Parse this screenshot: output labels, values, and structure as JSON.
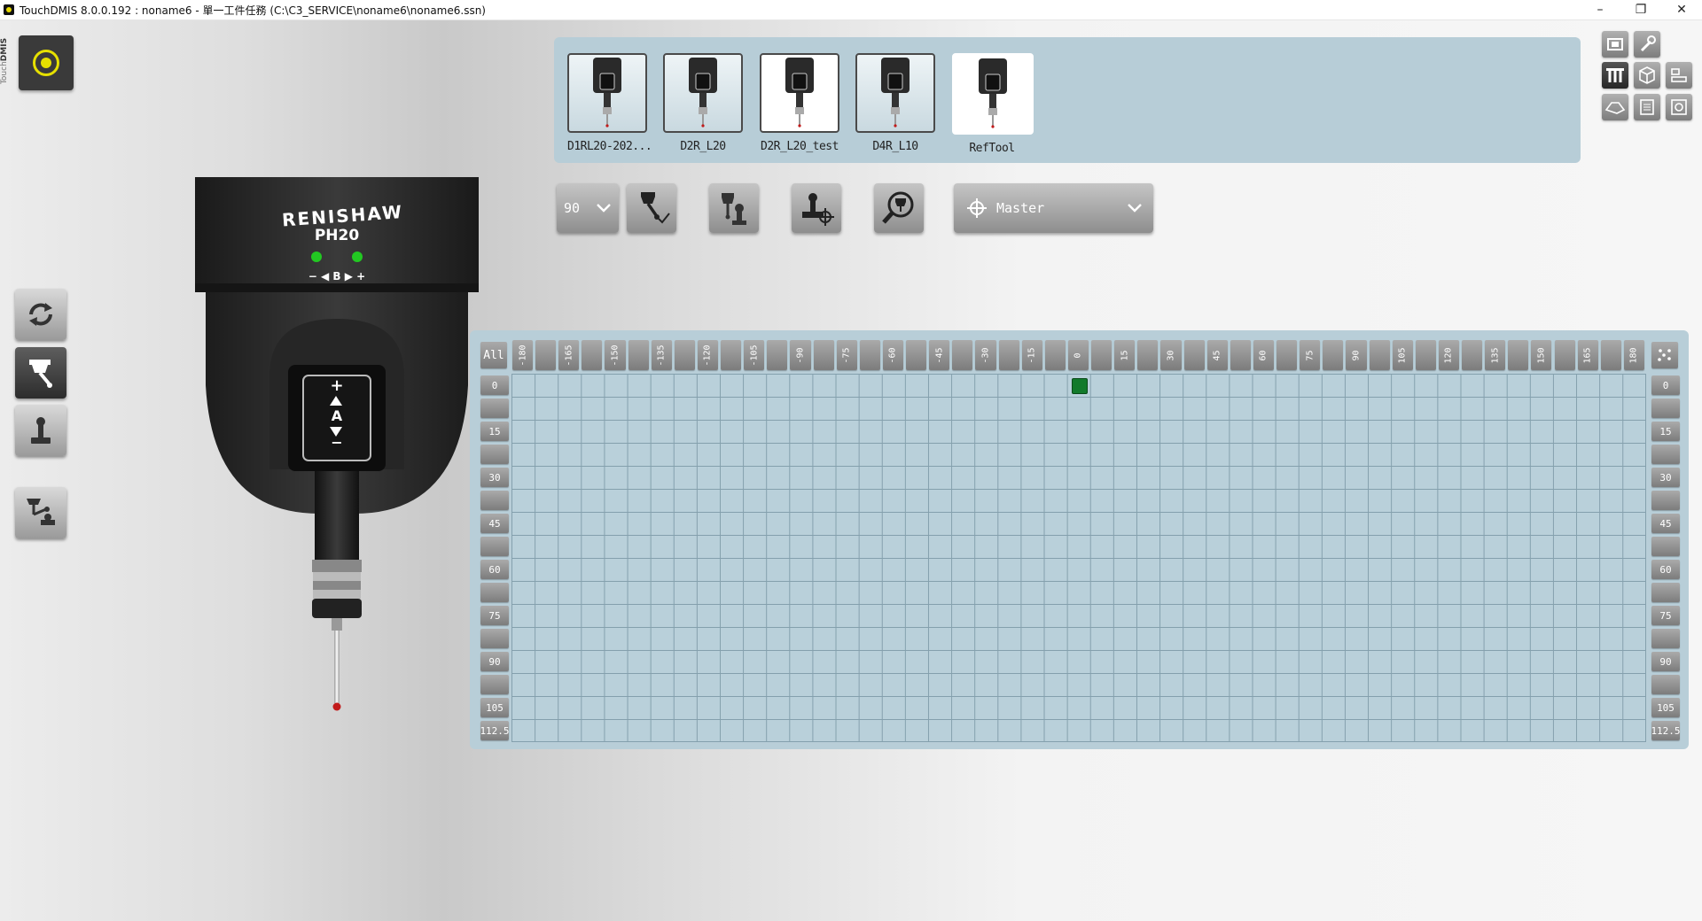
{
  "window": {
    "title": "TouchDMIS 8.0.0.192 :  noname6 - 單一工件任務    (C:\\C3_SERVICE\\noname6\\noname6.ssn)",
    "controls": [
      "–",
      "❐",
      "✕"
    ]
  },
  "brand": {
    "prefix": "Touch",
    "strong": "DMIS"
  },
  "probe_head": {
    "maker": "RENISHAW",
    "model": "PH20",
    "b_axis_label": "− ◀ B ▶ +",
    "a_axis_plus": "+",
    "a_axis_label": "A",
    "a_axis_minus": "−",
    "led_color": "#22c822"
  },
  "tools": [
    {
      "label": "D1RL20-202...",
      "selected": false
    },
    {
      "label": "D2R_L20",
      "selected": false
    },
    {
      "label": "D2R_L20_test",
      "selected": false,
      "highlight": true
    },
    {
      "label": "D4R_L10",
      "selected": false
    },
    {
      "label": "RefTool",
      "selected": true
    }
  ],
  "toolbar": {
    "angle_value": "90",
    "reference_value": "Master"
  },
  "grid": {
    "all_label": "All",
    "columns": [
      "-180",
      "-165",
      "-150",
      "-135",
      "-120",
      "-105",
      "-90",
      "-75",
      "-60",
      "-45",
      "-30",
      "-15",
      "0",
      "15",
      "30",
      "45",
      "60",
      "75",
      "90",
      "105",
      "120",
      "135",
      "150",
      "165",
      "180"
    ],
    "rows": [
      "0",
      "",
      "15",
      "",
      "30",
      "",
      "45",
      "",
      "60",
      "",
      "75",
      "",
      "90",
      "",
      "105",
      "112.5"
    ],
    "active_cells": [
      {
        "a": "0",
        "b": "0"
      }
    ],
    "active_color": "#127a2b"
  }
}
